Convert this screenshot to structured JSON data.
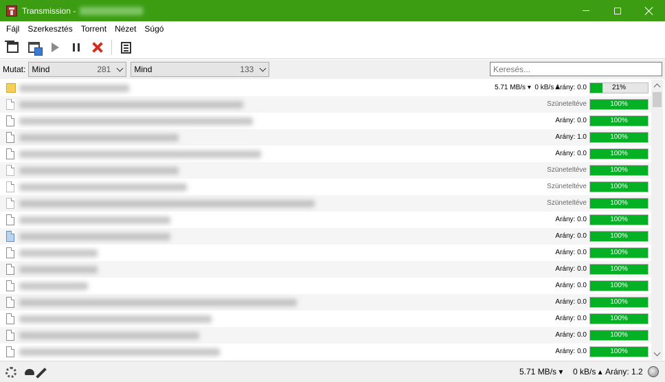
{
  "window": {
    "title": "Transmission -",
    "accent_color": "#3c9d13"
  },
  "menu": [
    "Fájl",
    "Szerkesztés",
    "Torrent",
    "Nézet",
    "Súgó"
  ],
  "toolbar": {
    "buttons": [
      "open-torrent-icon",
      "open-url-icon",
      "start-icon",
      "pause-icon",
      "remove-icon",
      "properties-icon"
    ]
  },
  "filter": {
    "label": "Mutat:",
    "combo1_text": "Mind",
    "combo1_count": "281",
    "combo2_text": "Mind",
    "combo2_count": "133",
    "search_placeholder": "Keresés..."
  },
  "rows": [
    {
      "icon": "folder",
      "down": "5.71 MB/s ▾",
      "up": "0 kB/s ▴",
      "status": "Arány: 0.0",
      "progress": 21,
      "progress_text": "21%"
    },
    {
      "icon": "file-pale",
      "status": "Szüneteltéve",
      "progress": 100,
      "progress_text": "100%"
    },
    {
      "icon": "file",
      "status": "Arány: 0.0",
      "progress": 100,
      "progress_text": "100%"
    },
    {
      "icon": "file",
      "status": "Arány: 1.0",
      "progress": 100,
      "progress_text": "100%"
    },
    {
      "icon": "file",
      "status": "Arány: 0.0",
      "progress": 100,
      "progress_text": "100%"
    },
    {
      "icon": "file-pale",
      "status": "Szüneteltéve",
      "progress": 100,
      "progress_text": "100%"
    },
    {
      "icon": "file-pale",
      "status": "Szüneteltéve",
      "progress": 100,
      "progress_text": "100%"
    },
    {
      "icon": "file-pale",
      "status": "Szüneteltéve",
      "progress": 100,
      "progress_text": "100%"
    },
    {
      "icon": "file",
      "status": "Arány: 0.0",
      "progress": 100,
      "progress_text": "100%"
    },
    {
      "icon": "file-sel",
      "status": "Arány: 0.0",
      "progress": 100,
      "progress_text": "100%"
    },
    {
      "icon": "file",
      "status": "Arány: 0.0",
      "progress": 100,
      "progress_text": "100%"
    },
    {
      "icon": "file",
      "status": "Arány: 0.0",
      "progress": 100,
      "progress_text": "100%"
    },
    {
      "icon": "file",
      "status": "Arány: 0.0",
      "progress": 100,
      "progress_text": "100%"
    },
    {
      "icon": "file",
      "status": "Arány: 0.0",
      "progress": 100,
      "progress_text": "100%"
    },
    {
      "icon": "file",
      "status": "Arány: 0.0",
      "progress": 100,
      "progress_text": "100%"
    },
    {
      "icon": "file",
      "status": "Arány: 0.0",
      "progress": 100,
      "progress_text": "100%"
    },
    {
      "icon": "file",
      "status": "Arány: 0.0",
      "progress": 100,
      "progress_text": "100%"
    }
  ],
  "statusbar": {
    "down": "5.71 MB/s ▾",
    "up": "0 kB/s ▴",
    "ratio": "Arány:  1.2"
  }
}
